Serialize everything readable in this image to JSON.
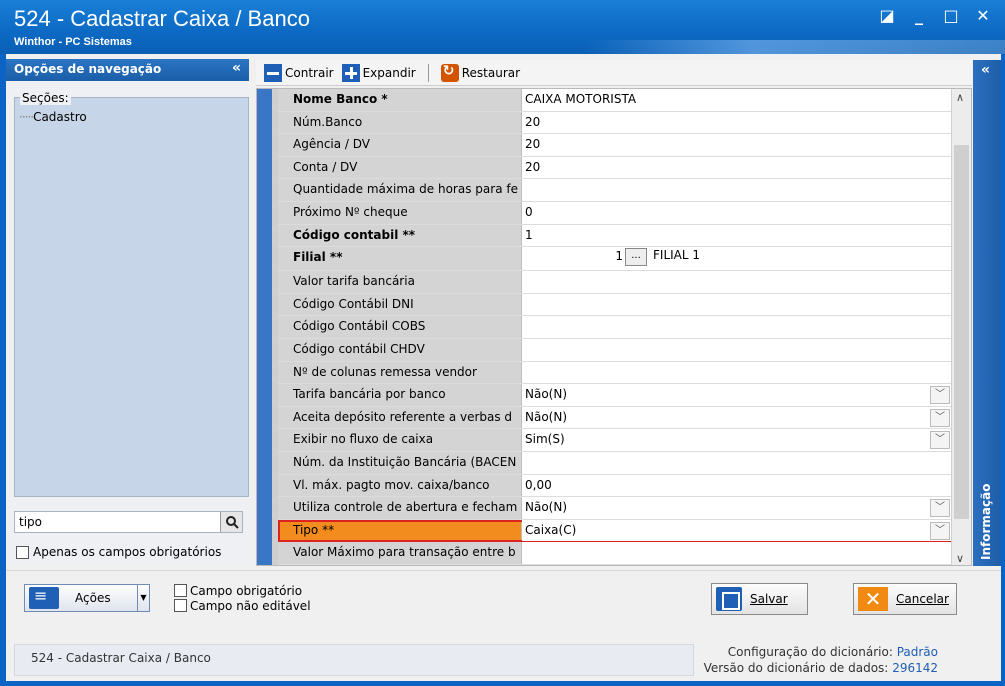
{
  "window": {
    "title": "524 - Cadastrar Caixa / Banco",
    "subtitle": "Winthor - PC Sistemas",
    "controls": [
      "◪",
      "_",
      "□",
      "✕"
    ]
  },
  "nav": {
    "header": "Opções de navegação",
    "collapse_glyph": "«",
    "sections_label": "Seções:",
    "tree_item": "Cadastro",
    "search_value": "tipo",
    "only_required_label": "Apenas os campos obrigatórios"
  },
  "toolbar": {
    "contract": "Contrair",
    "expand": "Expandir",
    "restore": "Restaurar"
  },
  "grid": {
    "rows": [
      {
        "label": "Nome Banco *",
        "value": "CAIXA MOTORISTA",
        "bold": true
      },
      {
        "label": "Núm.Banco",
        "value": "20"
      },
      {
        "label": "Agência / DV",
        "value": "20"
      },
      {
        "label": "Conta / DV",
        "value": "20"
      },
      {
        "label": "Quantidade máxima de horas para fe",
        "value": ""
      },
      {
        "label": "Próximo Nº cheque",
        "value": "0"
      },
      {
        "label": "Código contabil **",
        "value": "1",
        "bold": true
      },
      {
        "label": "Filial **",
        "value": "1",
        "extra": "FILIAL 1",
        "bold": true
      },
      {
        "label": "Valor tarifa bancária",
        "value": ""
      },
      {
        "label": "Código Contábil DNI",
        "value": ""
      },
      {
        "label": "Código Contábil COBS",
        "value": ""
      },
      {
        "label": "Código contábil CHDV",
        "value": ""
      },
      {
        "label": "Nº de colunas remessa vendor",
        "value": ""
      },
      {
        "label": "Tarifa bancária por banco",
        "value": "Não(N)"
      },
      {
        "label": "Aceita depósito referente a verbas d",
        "value": "Não(N)"
      },
      {
        "label": "Exibir no fluxo de caixa",
        "value": "Sim(S)"
      },
      {
        "label": "Núm. da Instituição Bancária (BACEN",
        "value": ""
      },
      {
        "label": "Vl. máx. pagto mov. caixa/banco",
        "value": "0,00"
      },
      {
        "label": "Utiliza controle de abertura e fecham",
        "value": "Não(N)"
      },
      {
        "label": "Tipo **",
        "value": "Caixa(C)"
      },
      {
        "label": "Valor Máximo para transação entre b",
        "value": ""
      }
    ],
    "dropdown_glyph": "﹀",
    "ellipsis": "...",
    "scroll_up": "∧",
    "scroll_down": "∨"
  },
  "info_tab": {
    "label": "Informação",
    "arrow": "«"
  },
  "bottom": {
    "actions_label": "Ações",
    "legend_required": "Campo obrigatório",
    "legend_not_editable": "Campo não editável",
    "save_label": "Salvar",
    "cancel_label": "Cancelar"
  },
  "status": {
    "left": "524 - Cadastrar Caixa / Banco",
    "dict_config_label": "Configuração do dicionário:",
    "dict_config_value": "Padrão",
    "dict_version_label": "Versão do dicionário de dados:",
    "dict_version_value": "296142"
  }
}
